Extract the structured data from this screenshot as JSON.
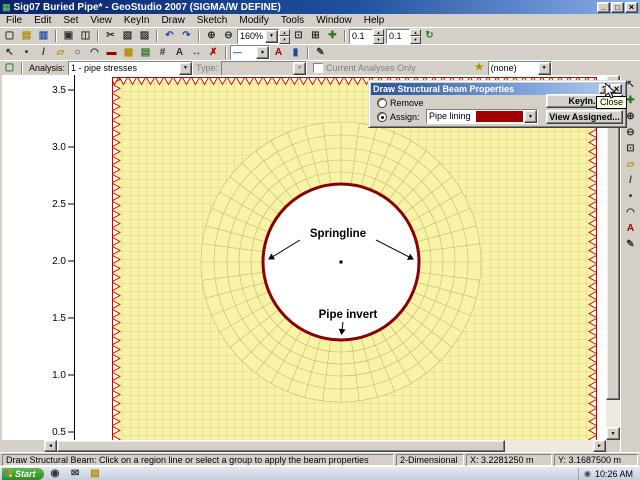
{
  "window": {
    "title": "Sig07 Buried Pipe* - GeoStudio 2007 (SIGMA/W DEFINE)"
  },
  "menu": {
    "items": [
      "File",
      "Edit",
      "Set",
      "View",
      "KeyIn",
      "Draw",
      "Sketch",
      "Modify",
      "Tools",
      "Window",
      "Help"
    ]
  },
  "toolbars": {
    "zoom_value": "160%",
    "spin_x": "0.1",
    "spin_y": "0.1",
    "analysis_label": "Analysis:",
    "analysis_value": "1 - pipe stresses",
    "type_label": "Type:",
    "type_value": "",
    "current_analyses_only": "Current Analyses Only",
    "none_value": "(none)"
  },
  "icons": {
    "app": "▦",
    "new_file": "▢",
    "open_folder": "▤",
    "save": "▥",
    "print": "▣",
    "print_preview": "◫",
    "cut": "✂",
    "copy": "▧",
    "paste": "▨",
    "undo": "↶",
    "redo": "↷",
    "zoom_in": "⊕",
    "zoom_out": "⊖",
    "zoom_page": "⊡",
    "zoom_extents": "⊞",
    "pan": "✚",
    "redraw": "↻",
    "select": "↖",
    "draw_point": "•",
    "draw_line": "/",
    "draw_region": "▱",
    "draw_circle": "○",
    "draw_arc": "◠",
    "draw_beam": "▬",
    "draw_material": "▦",
    "draw_boundary": "▤",
    "draw_mesh": "#",
    "draw_text": "A",
    "dimension": "↔",
    "erase": "✗",
    "line_style": "—",
    "text_color": "A",
    "fill_color": "▮",
    "favorites": "★",
    "sketch_pencil": "✎",
    "analysis_doc": "▢",
    "help": "?",
    "minimize": "_",
    "maximize": "□",
    "close": "×",
    "up_small": "▲",
    "down_small": "▼",
    "left_small": "◄",
    "right_small": "►",
    "mail": "✉",
    "tray": "◉"
  },
  "dialog": {
    "title": "Draw Structural Beam Properties",
    "remove_label": "Remove",
    "assign_label": "Assign:",
    "assign_value": "Pipe lining",
    "keyin_button": "KeyIn...",
    "view_assigned_button": "View Assigned...",
    "close_tooltip": "Close"
  },
  "canvas": {
    "axis_labels": [
      "3.5",
      "3.0",
      "2.5",
      "2.0",
      "1.5",
      "1.0",
      "0.5"
    ],
    "annotations": {
      "springline": "Springline",
      "pipe_invert": "Pipe invert"
    }
  },
  "status_bar": {
    "message": "Draw Structural Beam:  Click on a region line or select a group to apply the beam properties",
    "dimension": "2-Dimensional",
    "x_coord": "X:  3.2281250 m",
    "y_coord": "Y:  3.1687500 m"
  },
  "taskbar": {
    "start": "Start",
    "clock": "10:26 AM"
  },
  "colors": {
    "region_fill": "#f8f3a6",
    "mesh_line": "#c8b96a",
    "boundary_hatch": "#cc0000",
    "pipe_outline": "#8b0000",
    "material_swatch": "#a00000",
    "titlebar_blue": "#0a246a"
  }
}
